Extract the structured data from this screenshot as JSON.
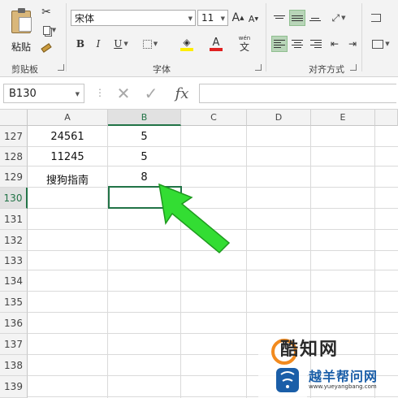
{
  "ribbon": {
    "clipboard": {
      "paste_label": "粘贴",
      "group_label": "剪贴板"
    },
    "font": {
      "font_name": "宋体",
      "font_size": "11",
      "grow_label": "A",
      "shrink_label": "A",
      "bold": "B",
      "italic": "I",
      "underline": "U",
      "font_color_label": "A",
      "phonetic_top": "wén",
      "phonetic_bottom": "文",
      "group_label": "字体"
    },
    "alignment": {
      "group_label": "对齐方式"
    }
  },
  "formula_bar": {
    "name_box": "B130",
    "fx": "fx",
    "cancel": "✕",
    "enter": "✓"
  },
  "grid": {
    "columns": [
      "A",
      "B",
      "C",
      "D",
      "E"
    ],
    "rows": [
      "127",
      "128",
      "129",
      "130",
      "131",
      "132",
      "133",
      "134",
      "135",
      "136",
      "137",
      "138",
      "139"
    ],
    "cells": {
      "A127": "24561",
      "B127": "5",
      "A128": "11245",
      "B128": "5",
      "A129": "搜狗指南",
      "B129": "8"
    },
    "selected_cell": "B130"
  },
  "watermark": {
    "name_1": "酷知网",
    "name_2": "越羊帮问网",
    "url": "www.yueyangbang.com"
  },
  "colors": {
    "excel_green": "#217346",
    "arrow_green": "#33dd33",
    "font_color_bar": "#e02020",
    "highlight_bar": "#ffee00"
  }
}
